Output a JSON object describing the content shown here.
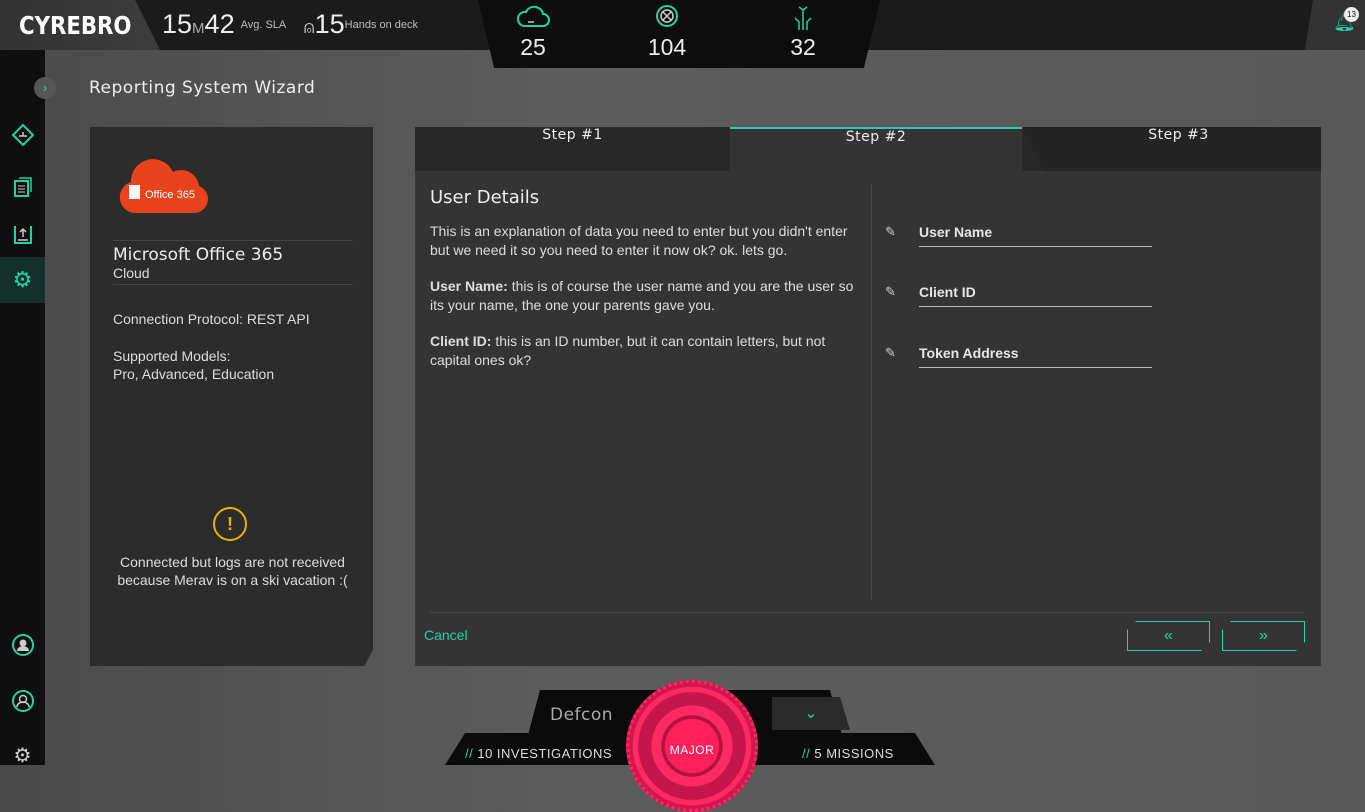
{
  "topbar": {
    "logo": "CYREBRO",
    "sla_minutes": "15",
    "sla_unit": "M",
    "sla_seconds": "42",
    "sla_label": "Avg. SLA",
    "hands": "15",
    "hands_label": "Hands on deck",
    "stats": [
      {
        "icon": "cloud-icon",
        "value": "25"
      },
      {
        "icon": "x-circle-icon",
        "value": "104"
      },
      {
        "icon": "circuit-icon",
        "value": "32"
      }
    ],
    "notifications": "13"
  },
  "page": {
    "title": "Reporting System Wizard"
  },
  "source": {
    "logo_text": "Office 365",
    "name": "Microsoft Office 365",
    "type": "Cloud",
    "protocol": "Connection Protocol: REST API",
    "models_label": "Supported Models:",
    "models": "Pro, Advanced, Education",
    "status": "Connected but logs are not received because Merav is on a ski vacation :("
  },
  "wizard": {
    "tabs": [
      "Step #1",
      "Step #2",
      "Step #3"
    ],
    "active_tab": 1,
    "heading": "User Details",
    "intro": "This is an explanation of data you need to enter but you didn't enter but we need it so you need to enter it now ok? ok. lets go.",
    "notes": [
      {
        "term": "User Name:",
        "text": " this is of course the user name and you are the user so its your name, the one your parents gave you."
      },
      {
        "term": "Client ID:",
        "text": " this is an ID number, but it can contain letters, but not capital ones ok?"
      }
    ],
    "fields": [
      "User Name",
      "Client ID",
      "Token Address"
    ],
    "cancel": "Cancel",
    "back": "«",
    "next": "»"
  },
  "defcon": {
    "label": "Defcon",
    "level": "MAJOR",
    "investigations": "10 INVESTIGATIONS",
    "missions": "5 MISSIONS",
    "prefix": "//"
  },
  "colors": {
    "accent": "#1ed3a5",
    "defcon": "#ff2a63"
  }
}
